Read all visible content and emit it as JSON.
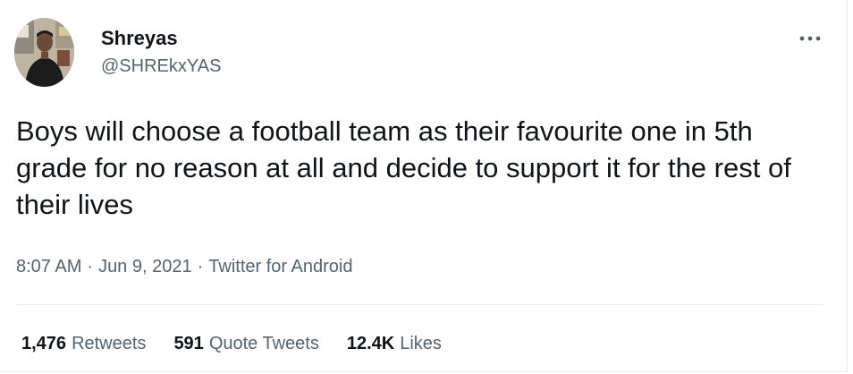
{
  "tweet": {
    "author": {
      "display_name": "Shreyas",
      "handle": "@SHREkxYAS"
    },
    "more_icon": "more-horizontal-icon",
    "text": "Boys will choose a football team as their favourite one in 5th grade for no reason at all and decide to support it for the rest of their lives",
    "time": "8:07 AM",
    "date": "Jun 9, 2021",
    "source": "Twitter for Android",
    "separator": "·",
    "stats": {
      "retweets": {
        "count": "1,476",
        "label": "Retweets"
      },
      "quote_tweets": {
        "count": "591",
        "label": "Quote Tweets"
      },
      "likes": {
        "count": "12.4K",
        "label": "Likes"
      }
    }
  },
  "colors": {
    "text_primary": "#0f1419",
    "text_secondary": "#536471",
    "border": "#e6ecf0"
  }
}
